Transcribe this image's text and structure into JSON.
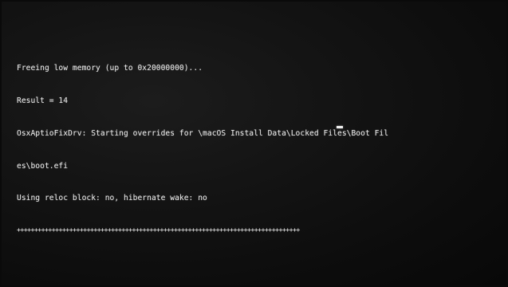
{
  "console": {
    "lines": [
      "Freeing low memory (up to 0x20000000)...",
      "Result = 14",
      "OsxAptioFixDrv: Starting overrides for \\macOS Install Data\\Locked Files\\Boot Fil",
      "es\\boot.efi",
      "Using reloc block: no, hibernate wake: no"
    ],
    "progress": "+++++++++++++++++++++++++++++++++++++++++++++++++++++++++++++++++++++++++++++++++"
  }
}
